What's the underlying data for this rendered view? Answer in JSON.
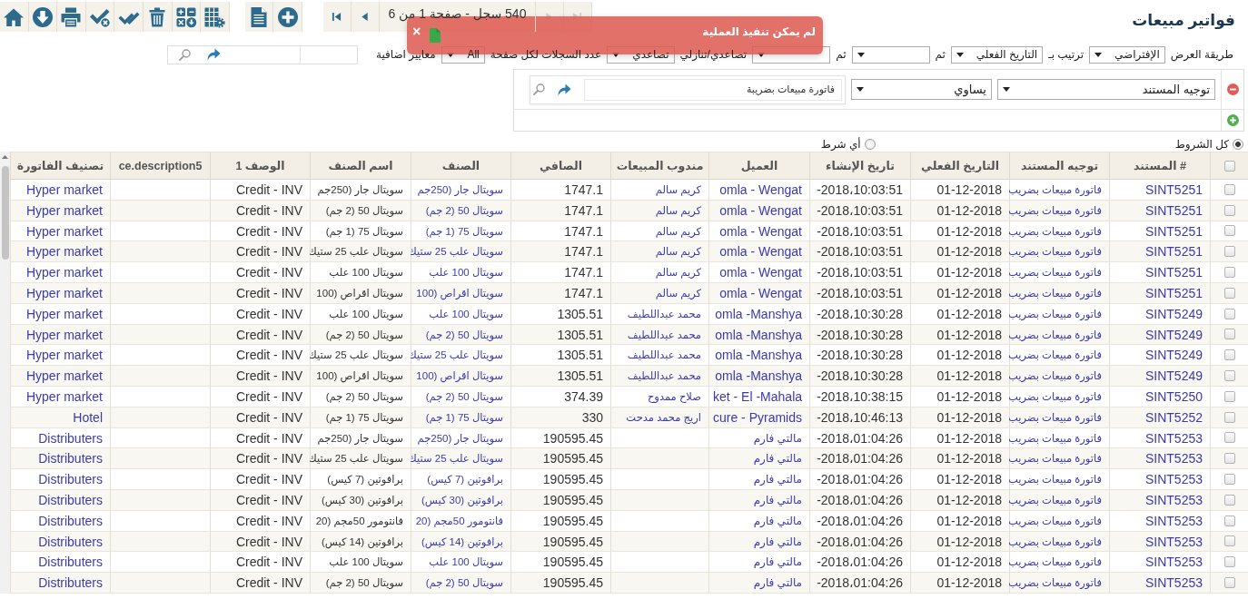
{
  "title": "فواتير مبيعات",
  "pager": {
    "first": {
      "disabled": false
    },
    "previous": {
      "disabled": false
    },
    "summary": "540 سجل - صفحة 1 من 6",
    "next": {
      "disabled": true
    },
    "last": {
      "disabled": true
    }
  },
  "display_options": [
    {
      "kind": "label",
      "text": "طريقة العرض"
    },
    {
      "kind": "select",
      "value": "الإفتراضي"
    },
    {
      "kind": "label",
      "text": "ترتيب بـ"
    },
    {
      "kind": "select",
      "value": "التاريخ الفعلي"
    },
    {
      "kind": "label",
      "text": "ثم"
    },
    {
      "kind": "select"
    },
    {
      "kind": "label",
      "text": "ثم"
    },
    {
      "kind": "select"
    },
    {
      "kind": "label",
      "text": "تصاعدي/تنازلي"
    },
    {
      "kind": "select",
      "value": "تصاعدي"
    },
    {
      "kind": "label",
      "text": "عدد السجلات لكل صفحة"
    },
    {
      "kind": "select",
      "value": "All"
    },
    {
      "kind": "label",
      "text": "معايير اضافية"
    }
  ],
  "filter": {
    "conditions": [
      {
        "field": "توجيه المستند",
        "operator": "يساوي",
        "value": "فاتورة مبيعات بضريبة"
      }
    ],
    "match_options": [
      {
        "label": "كل الشروط",
        "selected": true
      },
      {
        "label": "أي شرط",
        "selected": false
      }
    ]
  },
  "table": {
    "select_all": {
      "checked": false
    },
    "columns": [
      {
        "label": "# المستند",
        "kind": "link"
      },
      {
        "label": "توجيه المستند",
        "kind": "sublink"
      },
      {
        "label": "التاريخ الفعلي",
        "kind": "text"
      },
      {
        "label": "تاريخ الإنشاء",
        "kind": "datetime"
      },
      {
        "label": "العميل",
        "kind": "link"
      },
      {
        "label": "مندوب المبيعات",
        "kind": "sublink"
      },
      {
        "label": "الصافي",
        "kind": "number"
      },
      {
        "label": "الصنف",
        "kind": "sublink"
      },
      {
        "label": "اسم الصنف",
        "kind": "subtext"
      },
      {
        "label": "الوصف 1",
        "kind": "text"
      },
      {
        "label": "ce.description5",
        "kind": "text"
      },
      {
        "label": "تصنيف الفاتورة",
        "kind": "link"
      }
    ],
    "rows": [
      {
        "checked": false,
        "document_no": "SINT5251",
        "document_type": "فاتورة مبيعات بضريب",
        "actual_date": "01-12-2018",
        "created": "-2018،10:03:51",
        "customer": "omla - Wengat",
        "sales_rep": "كريم سالم",
        "net": "1747.1",
        "item": "سويتال جار (250جم",
        "item_name": "سويتال جار (250جم",
        "description_1": "Credit - INV",
        "invoice_category": "Hyper market"
      },
      {
        "checked": false,
        "document_no": "SINT5251",
        "document_type": "فاتورة مبيعات بضريب",
        "actual_date": "01-12-2018",
        "created": "-2018،10:03:51",
        "customer": "omla - Wengat",
        "sales_rep": "كريم سالم",
        "net": "1747.1",
        "item": "سويتال 50 (2 جم)",
        "item_name": "سويتال 50 (2 جم)",
        "description_1": "Credit - INV",
        "invoice_category": "Hyper market"
      },
      {
        "checked": false,
        "document_no": "SINT5251",
        "document_type": "فاتورة مبيعات بضريب",
        "actual_date": "01-12-2018",
        "created": "-2018،10:03:51",
        "customer": "omla - Wengat",
        "sales_rep": "كريم سالم",
        "net": "1747.1",
        "item": "سويتال 75 (1 جم)",
        "item_name": "سويتال 75 (1 جم)",
        "description_1": "Credit - INV",
        "invoice_category": "Hyper market"
      },
      {
        "checked": false,
        "document_no": "SINT5251",
        "document_type": "فاتورة مبيعات بضريب",
        "actual_date": "01-12-2018",
        "created": "-2018،10:03:51",
        "customer": "omla - Wengat",
        "sales_rep": "كريم سالم",
        "net": "1747.1",
        "item": "سويتال علب 25 ستيك",
        "item_name": "سويتال علب 25 ستيك",
        "description_1": "Credit - INV",
        "invoice_category": "Hyper market"
      },
      {
        "checked": false,
        "document_no": "SINT5251",
        "document_type": "فاتورة مبيعات بضريب",
        "actual_date": "01-12-2018",
        "created": "-2018،10:03:51",
        "customer": "omla - Wengat",
        "sales_rep": "كريم سالم",
        "net": "1747.1",
        "item": "سويتال 100 علب",
        "item_name": "سويتال 100 علب",
        "description_1": "Credit - INV",
        "invoice_category": "Hyper market"
      },
      {
        "checked": false,
        "document_no": "SINT5251",
        "document_type": "فاتورة مبيعات بضريب",
        "actual_date": "01-12-2018",
        "created": "-2018،10:03:51",
        "customer": "omla - Wengat",
        "sales_rep": "كريم سالم",
        "net": "1747.1",
        "item": "سويتال اقراص (100",
        "item_name": "سويتال اقراص (100",
        "description_1": "Credit - INV",
        "invoice_category": "Hyper market"
      },
      {
        "checked": false,
        "document_no": "SINT5249",
        "document_type": "فاتورة مبيعات بضريب",
        "actual_date": "01-12-2018",
        "created": "-2018،10:30:28",
        "customer": "omla -Manshya",
        "sales_rep": "محمد عبداللطيف",
        "net": "1305.51",
        "item": "سويتال 100 علب",
        "item_name": "سويتال 100 علب",
        "description_1": "Credit - INV",
        "invoice_category": "Hyper market"
      },
      {
        "checked": false,
        "document_no": "SINT5249",
        "document_type": "فاتورة مبيعات بضريب",
        "actual_date": "01-12-2018",
        "created": "-2018،10:30:28",
        "customer": "omla -Manshya",
        "sales_rep": "محمد عبداللطيف",
        "net": "1305.51",
        "item": "سويتال 50 (2 جم)",
        "item_name": "سويتال 50 (2 جم)",
        "description_1": "Credit - INV",
        "invoice_category": "Hyper market"
      },
      {
        "checked": false,
        "document_no": "SINT5249",
        "document_type": "فاتورة مبيعات بضريب",
        "actual_date": "01-12-2018",
        "created": "-2018،10:30:28",
        "customer": "omla -Manshya",
        "sales_rep": "محمد عبداللطيف",
        "net": "1305.51",
        "item": "سويتال علب 25 ستيك",
        "item_name": "سويتال علب 25 ستيك",
        "description_1": "Credit - INV",
        "invoice_category": "Hyper market"
      },
      {
        "checked": false,
        "document_no": "SINT5249",
        "document_type": "فاتورة مبيعات بضريب",
        "actual_date": "01-12-2018",
        "created": "-2018،10:30:28",
        "customer": "omla -Manshya",
        "sales_rep": "محمد عبداللطيف",
        "net": "1305.51",
        "item": "سويتال اقراص (100",
        "item_name": "سويتال اقراص (100",
        "description_1": "Credit - INV",
        "invoice_category": "Hyper market"
      },
      {
        "checked": false,
        "document_no": "SINT5250",
        "document_type": "فاتورة مبيعات بضريب",
        "actual_date": "01-12-2018",
        "created": "-2018،10:38:15",
        "customer": "ket - El -Mahala",
        "sales_rep": "صلاح ممدوح",
        "net": "374.39",
        "item": "سويتال 50 (2 جم)",
        "item_name": "سويتال 50 (2 جم)",
        "description_1": "Credit - INV",
        "invoice_category": "Hyper market"
      },
      {
        "checked": false,
        "document_no": "SINT5252",
        "document_type": "فاتورة مبيعات بضريب",
        "actual_date": "01-12-2018",
        "created": "-2018،10:46:13",
        "customer": "cure - Pyramids",
        "sales_rep": "اريج محمد مدحت",
        "net": "330",
        "item": "سويتال 75 (1 جم)",
        "item_name": "سويتال 75 (1 جم)",
        "description_1": "Credit - INV",
        "invoice_category": "Hotel"
      },
      {
        "checked": false,
        "document_no": "SINT5253",
        "document_type": "فاتورة مبيعات بضريب",
        "actual_date": "01-12-2018",
        "created": "-2018،01:04:26",
        "customer": "مالتي فارم",
        "net": "190595.45",
        "item": "سويتال جار (250جم",
        "item_name": "سويتال جار (250جم",
        "description_1": "Credit - INV",
        "invoice_category": "Distributers"
      },
      {
        "checked": false,
        "document_no": "SINT5253",
        "document_type": "فاتورة مبيعات بضريب",
        "actual_date": "01-12-2018",
        "created": "-2018،01:04:26",
        "customer": "مالتي فارم",
        "net": "190595.45",
        "item": "سويتال علب 25 ستيك",
        "item_name": "سويتال علب 25 ستيك",
        "description_1": "Credit - INV",
        "invoice_category": "Distributers"
      },
      {
        "checked": false,
        "document_no": "SINT5253",
        "document_type": "فاتورة مبيعات بضريب",
        "actual_date": "01-12-2018",
        "created": "-2018،01:04:26",
        "customer": "مالتي فارم",
        "net": "190595.45",
        "item": "برافوتين (7 كيس)",
        "item_name": "برافوتين (7 كيس)",
        "description_1": "Credit - INV",
        "invoice_category": "Distributers"
      },
      {
        "checked": false,
        "document_no": "SINT5253",
        "document_type": "فاتورة مبيعات بضريب",
        "actual_date": "01-12-2018",
        "created": "-2018،01:04:26",
        "customer": "مالتي فارم",
        "net": "190595.45",
        "item": "برافوتين (30 كيس)",
        "item_name": "برافوتين (30 كيس)",
        "description_1": "Credit - INV",
        "invoice_category": "Distributers"
      },
      {
        "checked": false,
        "document_no": "SINT5253",
        "document_type": "فاتورة مبيعات بضريب",
        "actual_date": "01-12-2018",
        "created": "-2018،01:04:26",
        "customer": "مالتي فارم",
        "net": "190595.45",
        "item": "فانتومور 50مجم (20",
        "item_name": "فانتومور 50مجم (20",
        "description_1": "Credit - INV",
        "invoice_category": "Distributers"
      },
      {
        "checked": false,
        "document_no": "SINT5253",
        "document_type": "فاتورة مبيعات بضريب",
        "actual_date": "01-12-2018",
        "created": "-2018،01:04:26",
        "customer": "مالتي فارم",
        "net": "190595.45",
        "item": "برافوتين (14 كيس)",
        "item_name": "برافوتين (14 كيس)",
        "description_1": "Credit - INV",
        "invoice_category": "Distributers"
      },
      {
        "checked": false,
        "document_no": "SINT5253",
        "document_type": "فاتورة مبيعات بضريب",
        "actual_date": "01-12-2018",
        "created": "-2018،01:04:26",
        "customer": "مالتي فارم",
        "net": "190595.45",
        "item": "سويتال 100 علب",
        "item_name": "سويتال 100 علب",
        "description_1": "Credit - INV",
        "invoice_category": "Distributers"
      },
      {
        "checked": false,
        "document_no": "SINT5253",
        "document_type": "فاتورة مبيعات بضريب",
        "actual_date": "01-12-2018",
        "created": "-2018،01:04:26",
        "customer": "مالتي فارم",
        "net": "190595.45",
        "item": "سويتال 50 (2 جم)",
        "item_name": "سويتال 50 (2 جم)",
        "description_1": "Credit - INV",
        "invoice_category": "Distributers"
      }
    ]
  },
  "error_popup": {
    "message": "لم يمكن تنفيذ العملية",
    "close": "×"
  }
}
